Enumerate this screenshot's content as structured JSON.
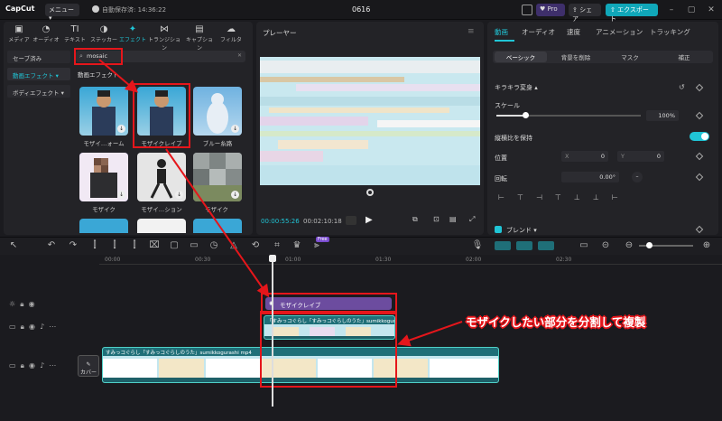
{
  "app": {
    "logo": "CapCut",
    "menu_label": "メニュー",
    "autosave": "自動保存済: 14:36:22",
    "project_title": "0616",
    "pro_label": "Pro",
    "share_label": "シェア",
    "export_label": "エクスポート"
  },
  "toolbar_tabs": [
    {
      "label": "メディア",
      "icon": "media-icon"
    },
    {
      "label": "オーディオ",
      "icon": "audio-icon"
    },
    {
      "label": "テキスト",
      "icon": "text-icon"
    },
    {
      "label": "ステッカー",
      "icon": "sticker-icon"
    },
    {
      "label": "エフェクト",
      "icon": "effects-icon",
      "active": true
    },
    {
      "label": "トランジション",
      "icon": "transition-icon"
    },
    {
      "label": "キャプション",
      "icon": "caption-icon"
    },
    {
      "label": "フィルタ",
      "icon": "filter-icon"
    }
  ],
  "side_nav": [
    {
      "label": "セーブ済み"
    },
    {
      "label": "動画エフェクト",
      "active": true
    },
    {
      "label": "ボディエフェクト"
    }
  ],
  "search": {
    "value": "mosaic"
  },
  "effects_section": "動画エフェクト",
  "effects": [
    {
      "label": "モザイ…ォーム"
    },
    {
      "label": "モザイクレイブ"
    },
    {
      "label": "ブルー糸路"
    },
    {
      "label": "モザイク"
    },
    {
      "label": "モザイ…ション"
    },
    {
      "label": "モザイク"
    }
  ],
  "player": {
    "title": "プレーヤー",
    "current_time": "00:00:55:26",
    "total_time": "00:02:10:18"
  },
  "right_panel": {
    "tabs": [
      "動画",
      "オーディオ",
      "速度",
      "アニメーション",
      "トラッキング"
    ],
    "sub_tabs": [
      "ベーシック",
      "背景を削除",
      "マスク",
      "補正"
    ],
    "kirakira_label": "キラキラ変身",
    "scale_label": "スケール",
    "scale_value": "100%",
    "aspect_label": "縦横比を保持",
    "position_label": "位置",
    "pos_x": "0",
    "pos_y": "0",
    "rotate_label": "回転",
    "rotate_value": "0.00°",
    "blend_label": "ブレンド"
  },
  "timeline": {
    "ticks": [
      "00:00",
      "00:30",
      "01:00",
      "01:30",
      "02:00",
      "02:30"
    ],
    "free_badge": "Free",
    "effect_clip_label": "モザイクレイブ",
    "clip_title": "「すみっコぐらし「すみっコぐらしのうた」sumikkogurashi.mp4",
    "clip_title_short": "すみっコぐらし「すみっコぐらしのうた」sumikkogurashi mp4",
    "cover_label": "カバー"
  },
  "annotation": "モザイクしたい部分を分割して複製",
  "colors": {
    "accent": "#20c5d6",
    "annotation_red": "#e5161b",
    "effect_clip": "#6c4c9f"
  }
}
